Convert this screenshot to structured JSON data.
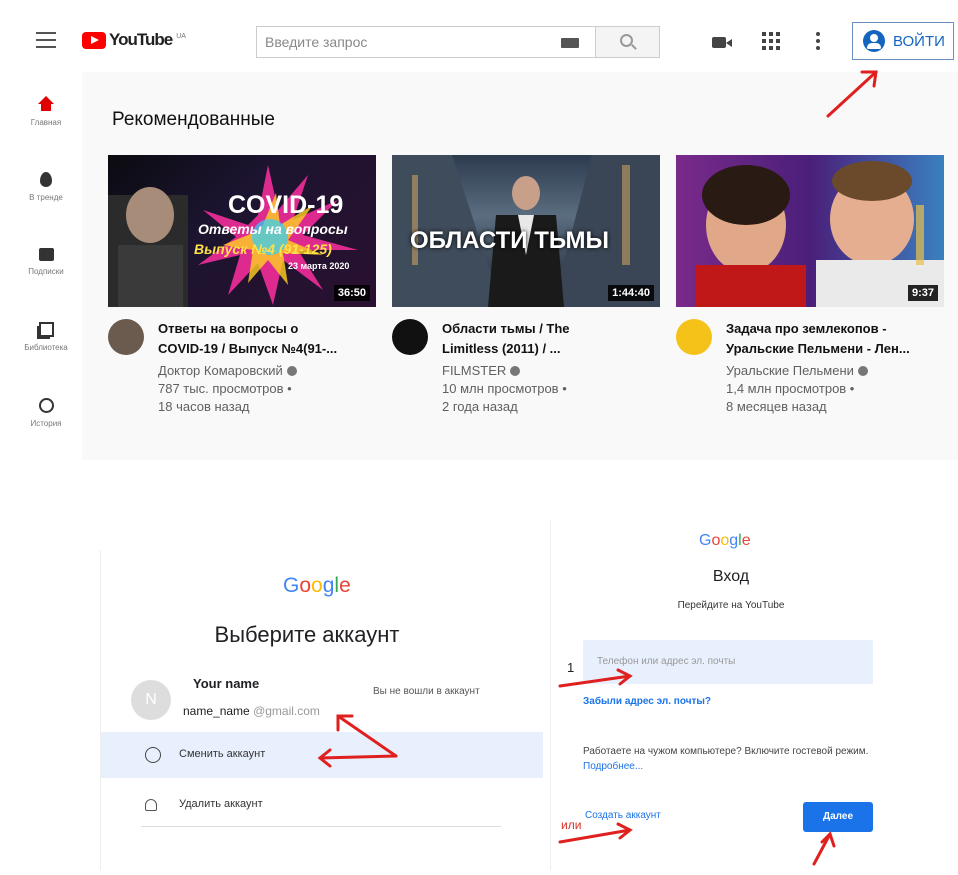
{
  "youtube": {
    "logo_text": "YouTube",
    "logo_region": "UA",
    "search": {
      "placeholder": "Введите запрос"
    },
    "signin_label": "ВОЙТИ",
    "sidebar": [
      {
        "label": "Главная",
        "icon": "home-icon"
      },
      {
        "label": "В тренде",
        "icon": "fire-icon"
      },
      {
        "label": "Подписки",
        "icon": "subscriptions-icon"
      },
      {
        "label": "Библиотека",
        "icon": "library-icon"
      },
      {
        "label": "История",
        "icon": "history-icon"
      }
    ],
    "section_title": "Рекомендованные",
    "videos": [
      {
        "title_line1": "Ответы на вопросы о",
        "title_line2": "COVID-19 / Выпуск №4(91-...",
        "channel": "Доктор Комаровский",
        "views": "787 тыс. просмотров •",
        "age": "18 часов назад",
        "duration": "36:50",
        "thumb_line1": "COVID-19",
        "thumb_line2": "Ответы на вопросы",
        "thumb_line3": "Выпуск №4 (91-125)",
        "thumb_line4": "23 марта 2020"
      },
      {
        "title_line1": "Области тьмы / The",
        "title_line2": "Limitless (2011) / ...",
        "channel": "FILMSTER",
        "views": "10 млн просмотров •",
        "age": "2 года назад",
        "duration": "1:44:40",
        "thumb_line1": "ОБЛАСТИ ТЬМЫ"
      },
      {
        "title_line1": "Задача про землекопов -",
        "title_line2": "Уральские Пельмени - Лен...",
        "channel": "Уральские Пельмени",
        "views": "1,4 млн просмотров •",
        "age": "8 месяцев назад",
        "duration": "9:37"
      }
    ]
  },
  "choose_account": {
    "logo": [
      "G",
      "o",
      "o",
      "g",
      "l",
      "e"
    ],
    "title": "Выберите аккаунт",
    "account": {
      "initial": "N",
      "name": "Your name",
      "email_user": "name_name",
      "email_domain": "@gmail.com",
      "status": "Вы не вошли в аккаунт"
    },
    "switch_label": "Сменить аккаунт",
    "remove_label": "Удалить аккаунт"
  },
  "sign_in": {
    "logo": [
      "G",
      "o",
      "o",
      "g",
      "l",
      "e"
    ],
    "title": "Вход",
    "subtitle": "Перейдите на YouTube",
    "step_number": "1",
    "input_placeholder": "Телефон или адрес эл. почты",
    "forgot_email": "Забыли адрес эл. почты?",
    "guest_text": "Работаете на чужом компьютере? Включите гостевой режим.",
    "guest_link": "Подробнее...",
    "or_label": "или",
    "create_account": "Создать аккаунт",
    "next_label": "Далее"
  },
  "colors": {
    "youtube_red": "#ff0000",
    "google_blue": "#1a73e8",
    "annotation_red": "#e0201e"
  }
}
